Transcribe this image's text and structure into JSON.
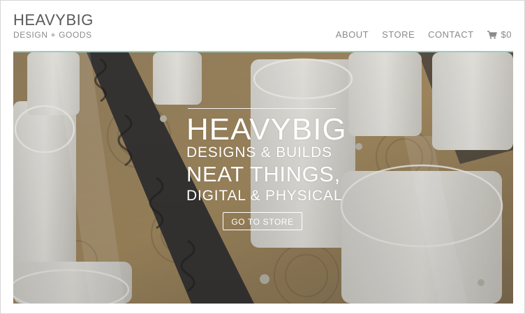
{
  "brand": {
    "name": "HEAVYBIG",
    "tagline": "DESIGN + GOODS"
  },
  "nav": {
    "items": [
      {
        "label": "ABOUT"
      },
      {
        "label": "STORE"
      },
      {
        "label": "CONTACT"
      }
    ],
    "cart": {
      "icon": "cart-icon",
      "amount": "$0"
    }
  },
  "hero": {
    "title": "HEAVYBIG",
    "line2": "DESIGNS & BUILDS",
    "line3": "NEAT THINGS,",
    "line4": "DIGITAL & PHYSICAL",
    "cta_label": "GO TO STORE"
  },
  "colors": {
    "accent": "#8cd3c5",
    "text_muted": "#8a8a8a",
    "brand_text": "#5a5a5a"
  }
}
